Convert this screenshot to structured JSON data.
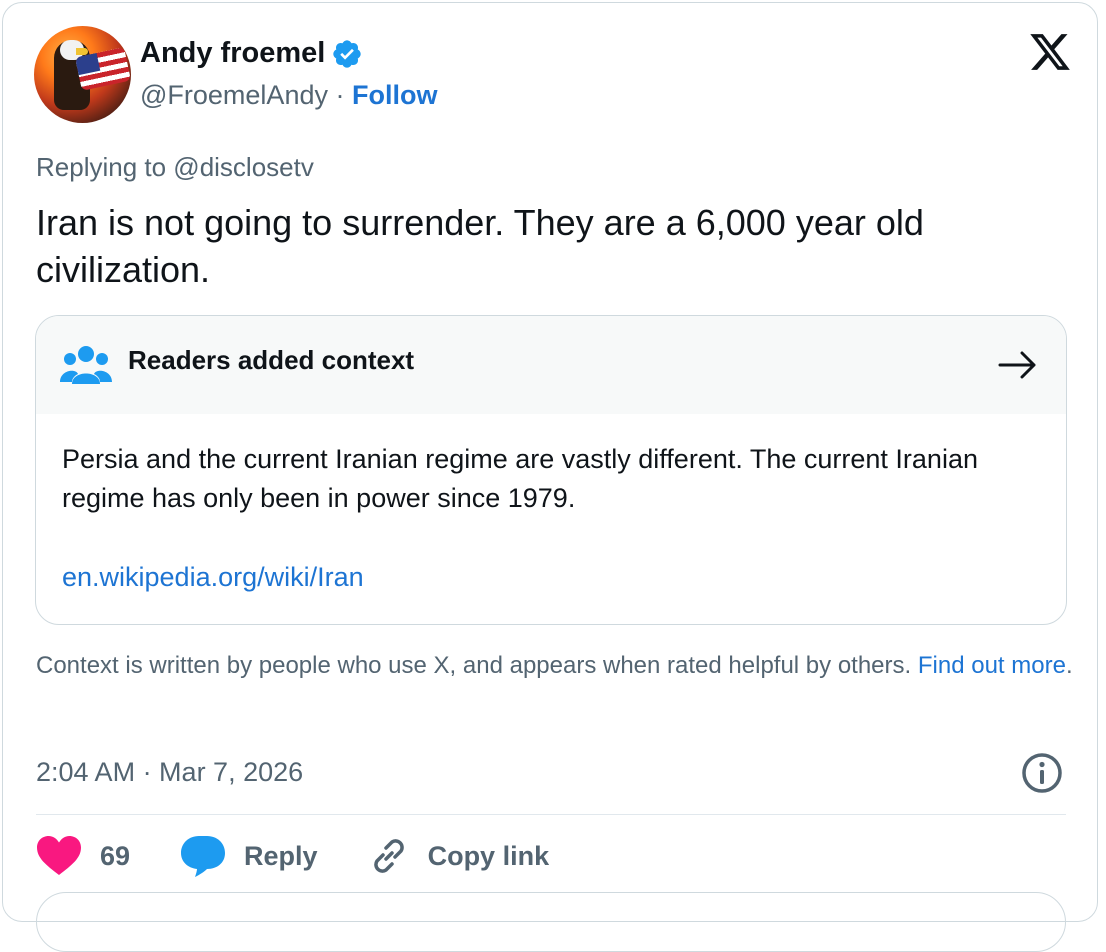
{
  "author": {
    "name": "Andy froemel",
    "handle": "@FroemelAndy",
    "separator": " · ",
    "follow_label": "Follow"
  },
  "icons": {
    "verified": "verified-badge-icon",
    "logo": "x-logo-icon",
    "readers": "readers-group-icon",
    "arrow": "arrow-right-icon",
    "info": "info-circle-icon",
    "like": "heart-icon",
    "reply": "speech-bubble-icon",
    "copy": "link-icon"
  },
  "colors": {
    "accent": "#1d9bf0",
    "link": "#1d74d3",
    "heart": "#f91880",
    "muted": "#536471"
  },
  "tweet": {
    "replying_to": "Replying to @disclosetv",
    "text": "Iran is not going to surrender. They are a 6,000 year old civilization."
  },
  "context_note": {
    "title": "Readers added context",
    "body": "Persia and the current Iranian regime are vastly different. The current Iranian regime has only been in power since 1979.",
    "link": "en.wikipedia.org/wiki/Iran"
  },
  "disclaimer": {
    "text": "Context is written by people who use X, and appears when rated helpful by others. ",
    "link": "Find out more",
    "end": "."
  },
  "timestamp": "2:04 AM · Mar 7, 2026",
  "actions": {
    "likes": "69",
    "reply_label": "Reply",
    "copy_label": "Copy link"
  }
}
